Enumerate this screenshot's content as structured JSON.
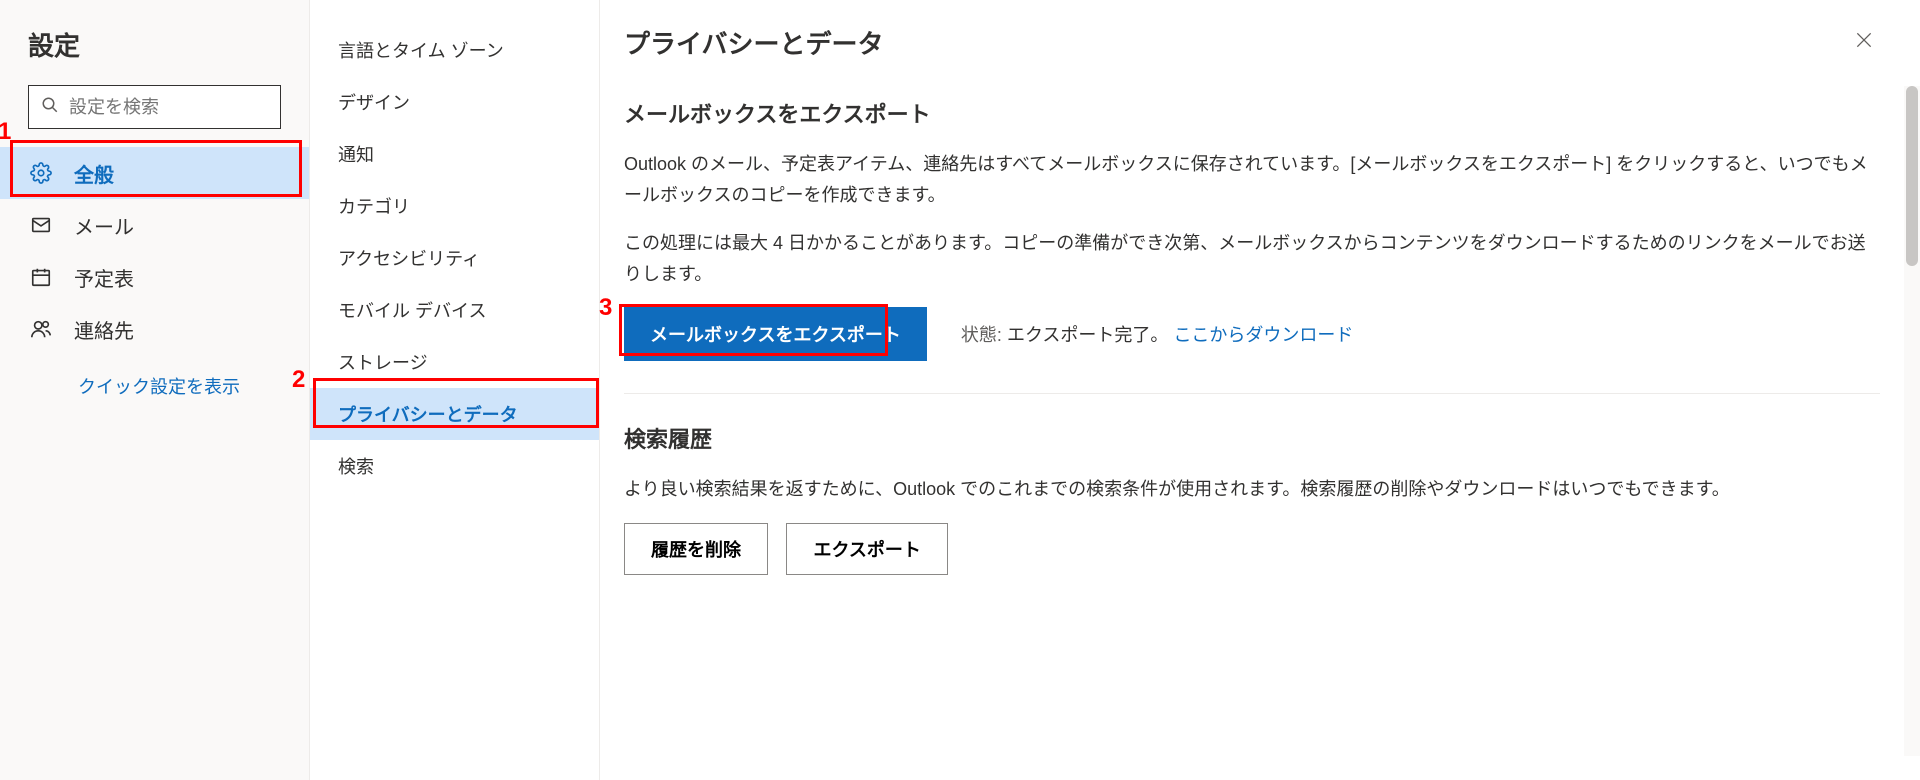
{
  "sidebar": {
    "title": "設定",
    "search_placeholder": "設定を検索",
    "items": [
      {
        "label": "全般",
        "icon": "gear",
        "active": true
      },
      {
        "label": "メール",
        "icon": "mail",
        "active": false
      },
      {
        "label": "予定表",
        "icon": "calendar",
        "active": false
      },
      {
        "label": "連絡先",
        "icon": "people",
        "active": false
      }
    ],
    "quick_link": "クイック設定を表示"
  },
  "subnav": {
    "items": [
      {
        "label": "言語とタイム ゾーン",
        "active": false
      },
      {
        "label": "デザイン",
        "active": false
      },
      {
        "label": "通知",
        "active": false
      },
      {
        "label": "カテゴリ",
        "active": false
      },
      {
        "label": "アクセシビリティ",
        "active": false
      },
      {
        "label": "モバイル デバイス",
        "active": false
      },
      {
        "label": "ストレージ",
        "active": false
      },
      {
        "label": "プライバシーとデータ",
        "active": true
      },
      {
        "label": "検索",
        "active": false
      }
    ]
  },
  "main": {
    "title": "プライバシーとデータ",
    "export": {
      "heading": "メールボックスをエクスポート",
      "p1": "Outlook のメール、予定表アイテム、連絡先はすべてメールボックスに保存されています。[メールボックスをエクスポート] をクリックすると、いつでもメールボックスのコピーを作成できます。",
      "p2": "この処理には最大 4 日かかることがあります。コピーの準備ができ次第、メールボックスからコンテンツをダウンロードするためのリンクをメールでお送りします。",
      "button": "メールボックスをエクスポート",
      "status_label": "状態:",
      "status_value": "エクスポート完了。",
      "download_link": "ここからダウンロード"
    },
    "history": {
      "heading": "検索履歴",
      "p": "より良い検索結果を返すために、Outlook でのこれまでの検索条件が使用されます。検索履歴の削除やダウンロードはいつでもできます。",
      "delete_button": "履歴を削除",
      "export_button": "エクスポート"
    }
  },
  "annotations": {
    "1": "1",
    "2": "2",
    "3": "3"
  }
}
